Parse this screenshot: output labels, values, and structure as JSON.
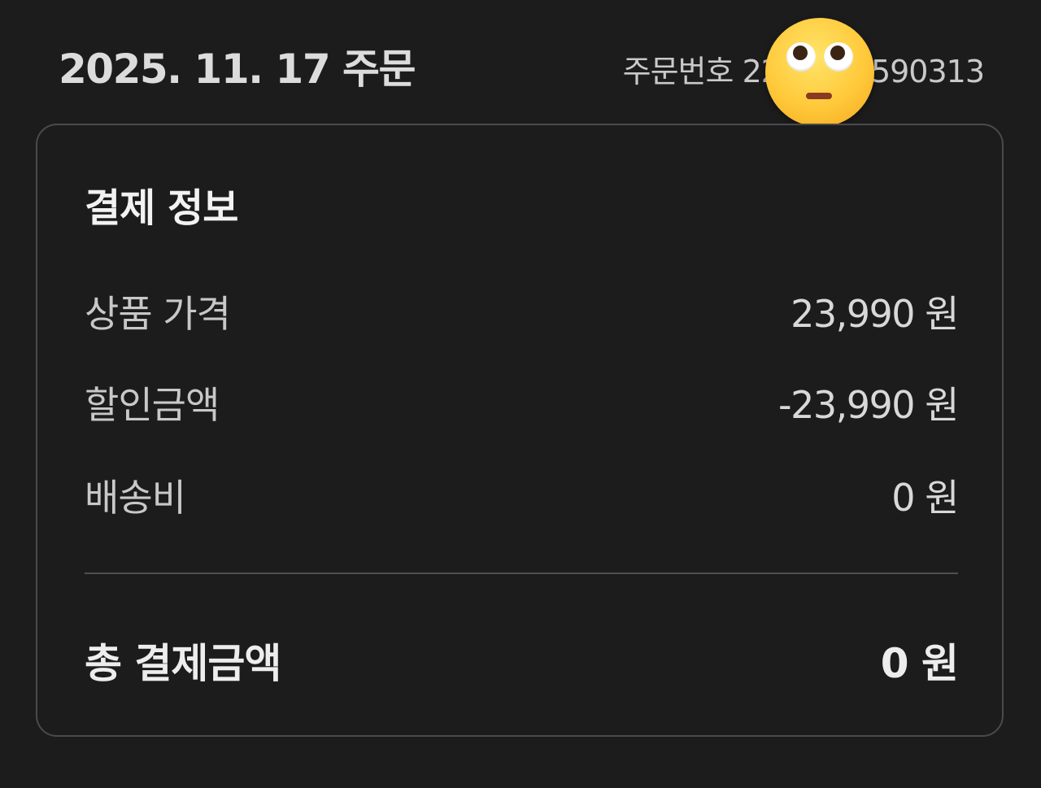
{
  "header": {
    "order_date": "2025. 11. 17 주문",
    "order_number_label": "주문번호",
    "order_number_visible_prefix": "22",
    "order_number_visible_suffix": "590313",
    "cover_emoji": "face-with-rolling-eyes-icon"
  },
  "payment": {
    "title": "결제 정보",
    "rows": [
      {
        "label": "상품 가격",
        "value": "23,990 원"
      },
      {
        "label": "할인금액",
        "value": "-23,990 원"
      },
      {
        "label": "배송비",
        "value": "0 원"
      }
    ],
    "total_label": "총 결제금액",
    "total_value": "0 원"
  },
  "colors": {
    "background": "#1c1c1d",
    "card_border": "#4a4a4c",
    "text_primary": "#f2f2f2",
    "text_secondary": "#c8c8c8",
    "emoji_yellow": "#ffc93a"
  }
}
